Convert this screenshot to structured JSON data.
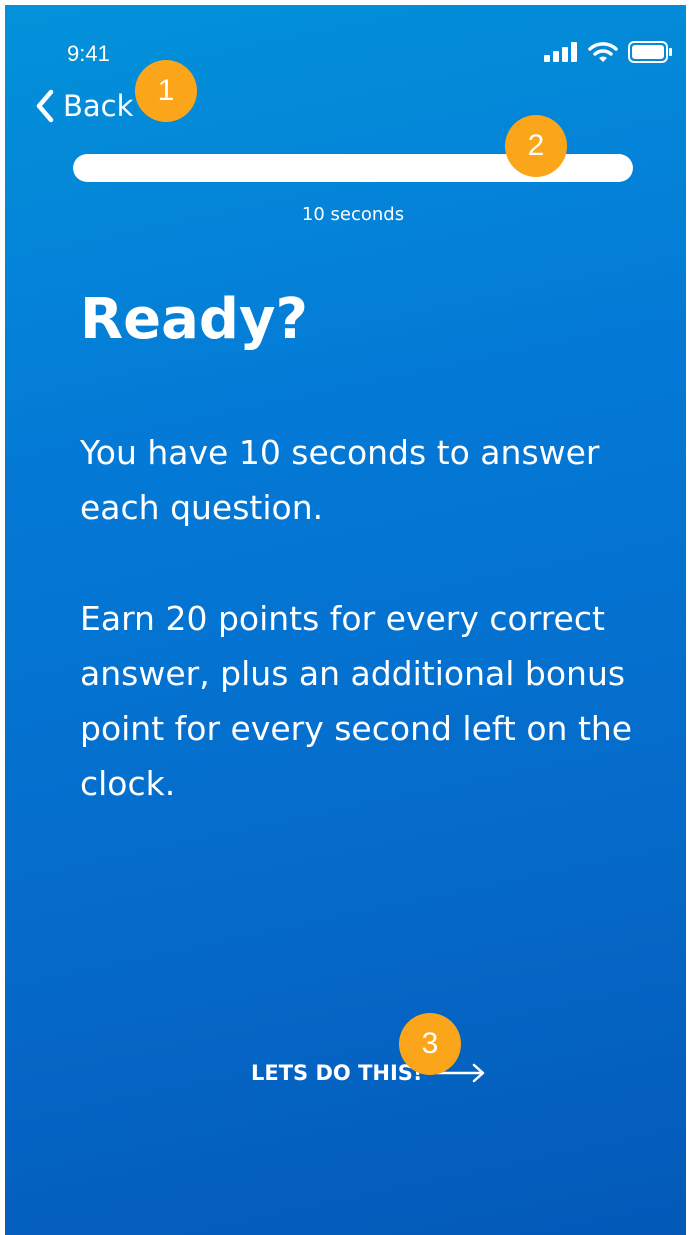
{
  "status_bar": {
    "time": "9:41",
    "icons": [
      "cellular-signal-icon",
      "wifi-icon",
      "battery-icon"
    ]
  },
  "nav": {
    "back_label": "Back"
  },
  "timer": {
    "progress": 1.0,
    "label": "10 seconds"
  },
  "content": {
    "title": "Ready?",
    "paragraph_1": "You have 10 seconds to answer each question.",
    "paragraph_2": "Earn 20 points for every correct answer, plus an additional bonus point for every second left on the clock."
  },
  "cta": {
    "label": "LETS DO THIS!",
    "icon": "arrow-right-icon"
  },
  "annotations": [
    "1",
    "2",
    "3"
  ],
  "colors": {
    "background_top": "#0392da",
    "background_bottom": "#0459b8",
    "marker": "#fba51a",
    "text": "#ffffff"
  }
}
